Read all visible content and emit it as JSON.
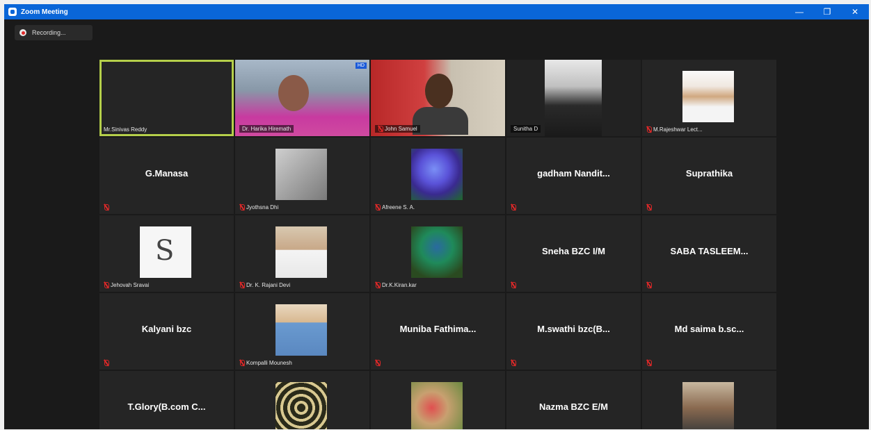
{
  "window": {
    "title": "Zoom Meeting",
    "controls": {
      "minimize": "—",
      "restore": "❐",
      "close": "✕"
    }
  },
  "recording": {
    "label": "Recording..."
  },
  "participants": [
    {
      "name": "Mr.Sinivas Reddy",
      "kind": "blank",
      "active": true,
      "muted": false
    },
    {
      "name": "Dr. Harika Hiremath",
      "kind": "video-pink",
      "muted": false,
      "badge": "HD"
    },
    {
      "name": "John Samuel",
      "kind": "video-red",
      "muted": true
    },
    {
      "name": "Sunitha D",
      "kind": "video-dim",
      "muted": false
    },
    {
      "name": "M.Rajeshwar Lect...",
      "kind": "avatar",
      "avatar": "man-formal",
      "muted": true
    },
    {
      "name": "G.Manasa",
      "kind": "text",
      "muted": true
    },
    {
      "name": "Jyothsna Dhi",
      "kind": "avatar",
      "avatar": "gray",
      "muted": true
    },
    {
      "name": "Afreene S. A.",
      "kind": "avatar",
      "avatar": "hydrangea",
      "muted": true
    },
    {
      "name": "gadham Nandit...",
      "kind": "text",
      "muted": true
    },
    {
      "name": "Suprathika",
      "kind": "text",
      "muted": true
    },
    {
      "name": "Jehovah Sravai",
      "kind": "avatar",
      "avatar": "seal",
      "muted": true
    },
    {
      "name": "Dr. K. Rajani Devi",
      "kind": "avatar",
      "avatar": "person-white",
      "muted": true
    },
    {
      "name": "Dr.K.Kiran.kar",
      "kind": "avatar",
      "avatar": "peacock",
      "muted": true
    },
    {
      "name": "Sneha BZC I/M",
      "kind": "text",
      "muted": true
    },
    {
      "name": "SABA TASLEEM...",
      "kind": "text",
      "muted": true
    },
    {
      "name": "Kalyani bzc",
      "kind": "text",
      "muted": true
    },
    {
      "name": "Kompalli Mounesh",
      "kind": "avatar",
      "avatar": "person-blue",
      "muted": true
    },
    {
      "name": "Muniba Fathima...",
      "kind": "text",
      "muted": true
    },
    {
      "name": "M.swathi bzc(B...",
      "kind": "text",
      "muted": true
    },
    {
      "name": "Md saima b.sc...",
      "kind": "text",
      "muted": true
    },
    {
      "name": "T.Glory(B.com C...",
      "kind": "text",
      "muted": false
    },
    {
      "name": "",
      "kind": "avatar",
      "avatar": "pattern",
      "muted": false
    },
    {
      "name": "",
      "kind": "avatar",
      "avatar": "flowers",
      "muted": false
    },
    {
      "name": "Nazma BZC E/M",
      "kind": "text",
      "muted": false
    },
    {
      "name": "",
      "kind": "avatar",
      "avatar": "man-photo",
      "muted": false
    }
  ]
}
